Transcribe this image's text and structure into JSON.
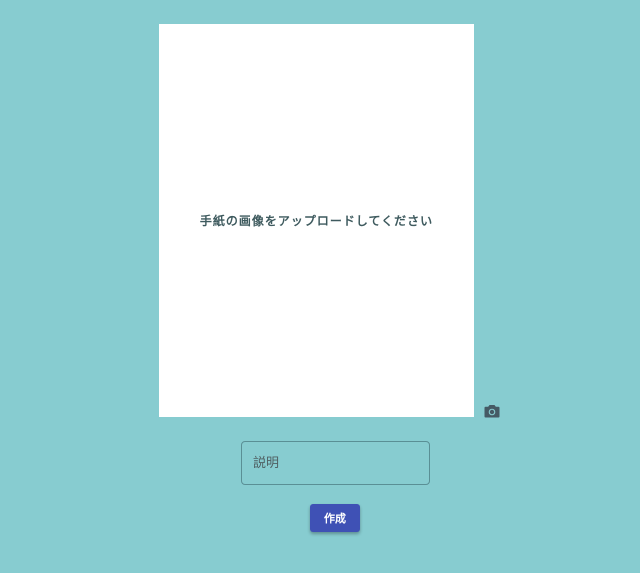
{
  "upload": {
    "prompt": "手紙の画像をアップロードしてください"
  },
  "camera": {
    "icon": "camera-icon"
  },
  "description": {
    "placeholder": "説明",
    "value": ""
  },
  "actions": {
    "create_label": "作成"
  },
  "colors": {
    "background": "#87ccd0",
    "card": "#ffffff",
    "primary_button": "#3f51b5",
    "prompt_text": "#3e5a5e",
    "icon": "#455a64"
  }
}
